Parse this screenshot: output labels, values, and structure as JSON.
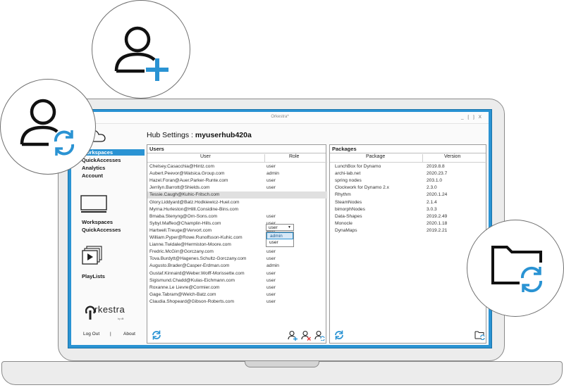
{
  "window": {
    "title": "Orkestra*",
    "controls": "_ [ ] X"
  },
  "hub_title_prefix": "Hub Settings : ",
  "hub_name": "myuserhub420a",
  "sidebar": {
    "top_items": [
      "Workspaces",
      "QuickAccesses",
      "Analytics",
      "Account"
    ],
    "mid_items": [
      "Workspaces",
      "QuickAccesses"
    ],
    "playlists": "PlayLists",
    "logout": "Log Out",
    "separator": "|",
    "about": "About",
    "brand": "rkestra",
    "brand_tag": "by dlt"
  },
  "users": {
    "title": "Users",
    "col_user": "User",
    "col_role": "Role",
    "rows": [
      {
        "email": "Chelsey.Casacchia@Hintz.com",
        "role": "user"
      },
      {
        "email": "Aubert.Peevor@Watsica.Group.com",
        "role": "admin"
      },
      {
        "email": "Hazel.Foran@Auer.Parker-Runte.com",
        "role": "user"
      },
      {
        "email": "Jerrilyn.Barrott@Shields.com",
        "role": "user"
      },
      {
        "email": "Tessie.Caugh@Kuhic-Fritsch.com",
        "role": "user"
      },
      {
        "email": "Glory.Liddyard@Batz.Hodkiewicz-Huel.com",
        "role": ""
      },
      {
        "email": "Myrna.Hurleston@Hilll.Considine-Bins.com",
        "role": ""
      },
      {
        "email": "Bmaba.Stenyng@Orn-Sons.com",
        "role": "user"
      },
      {
        "email": "Sybyl.Maffeo@Champlin-Hills.com",
        "role": "user"
      },
      {
        "email": "Hartwell.Treuge@Vervort.com",
        "role": "user"
      },
      {
        "email": "William.Pyper@Rowe.Runolfsson-Kuhic.com",
        "role": "user"
      },
      {
        "email": "Lianne.Twidale@Hermiston-Moore.com",
        "role": "user"
      },
      {
        "email": "Fredric.McGirr@Gorczany.com",
        "role": "user"
      },
      {
        "email": "Tova.Burdytt@Hagenes.Schultz-Gorczany.com",
        "role": "user"
      },
      {
        "email": "Augusto.Brader@Casper-Erdman.com",
        "role": "admin"
      },
      {
        "email": "Gustaf.Kinnaird@Weber.Wolff-Morissette.com",
        "role": "user"
      },
      {
        "email": "Sigismund.Chadd@Kulas-Eichmann.com",
        "role": "user"
      },
      {
        "email": "Roxanne.Le Lievre@Cormier.com",
        "role": "user"
      },
      {
        "email": "Gage.Tabram@Welch-Batz.com",
        "role": "user"
      },
      {
        "email": "Claudia.Shopeard@Gibson-Roberts.com",
        "role": "user"
      }
    ],
    "dropdown_value": "user",
    "dropdown_options": [
      "admin",
      "user"
    ]
  },
  "packages": {
    "title": "Packages",
    "col_package": "Package",
    "col_version": "Version",
    "rows": [
      {
        "name": "LunchBox for Dynamo",
        "version": "2019.8.8"
      },
      {
        "name": "archi-lab.net",
        "version": "2020.23.7"
      },
      {
        "name": "spring nodes",
        "version": "203.1.0"
      },
      {
        "name": "Clockwork for Dynamo 2.x",
        "version": "2.3.0"
      },
      {
        "name": "Rhythm",
        "version": "2020.1.24"
      },
      {
        "name": "SteamNodes",
        "version": "2.1.4"
      },
      {
        "name": "bimorphNodes",
        "version": "3.0.3"
      },
      {
        "name": "Data-Shapes",
        "version": "2019.2.49"
      },
      {
        "name": "Monocle",
        "version": "2020.1.18"
      },
      {
        "name": "DynaMaps",
        "version": "2019.2.21"
      }
    ]
  },
  "colors": {
    "accent": "#2a93d3",
    "laptop": "#ececec",
    "highlight": "#e0e0e0"
  }
}
